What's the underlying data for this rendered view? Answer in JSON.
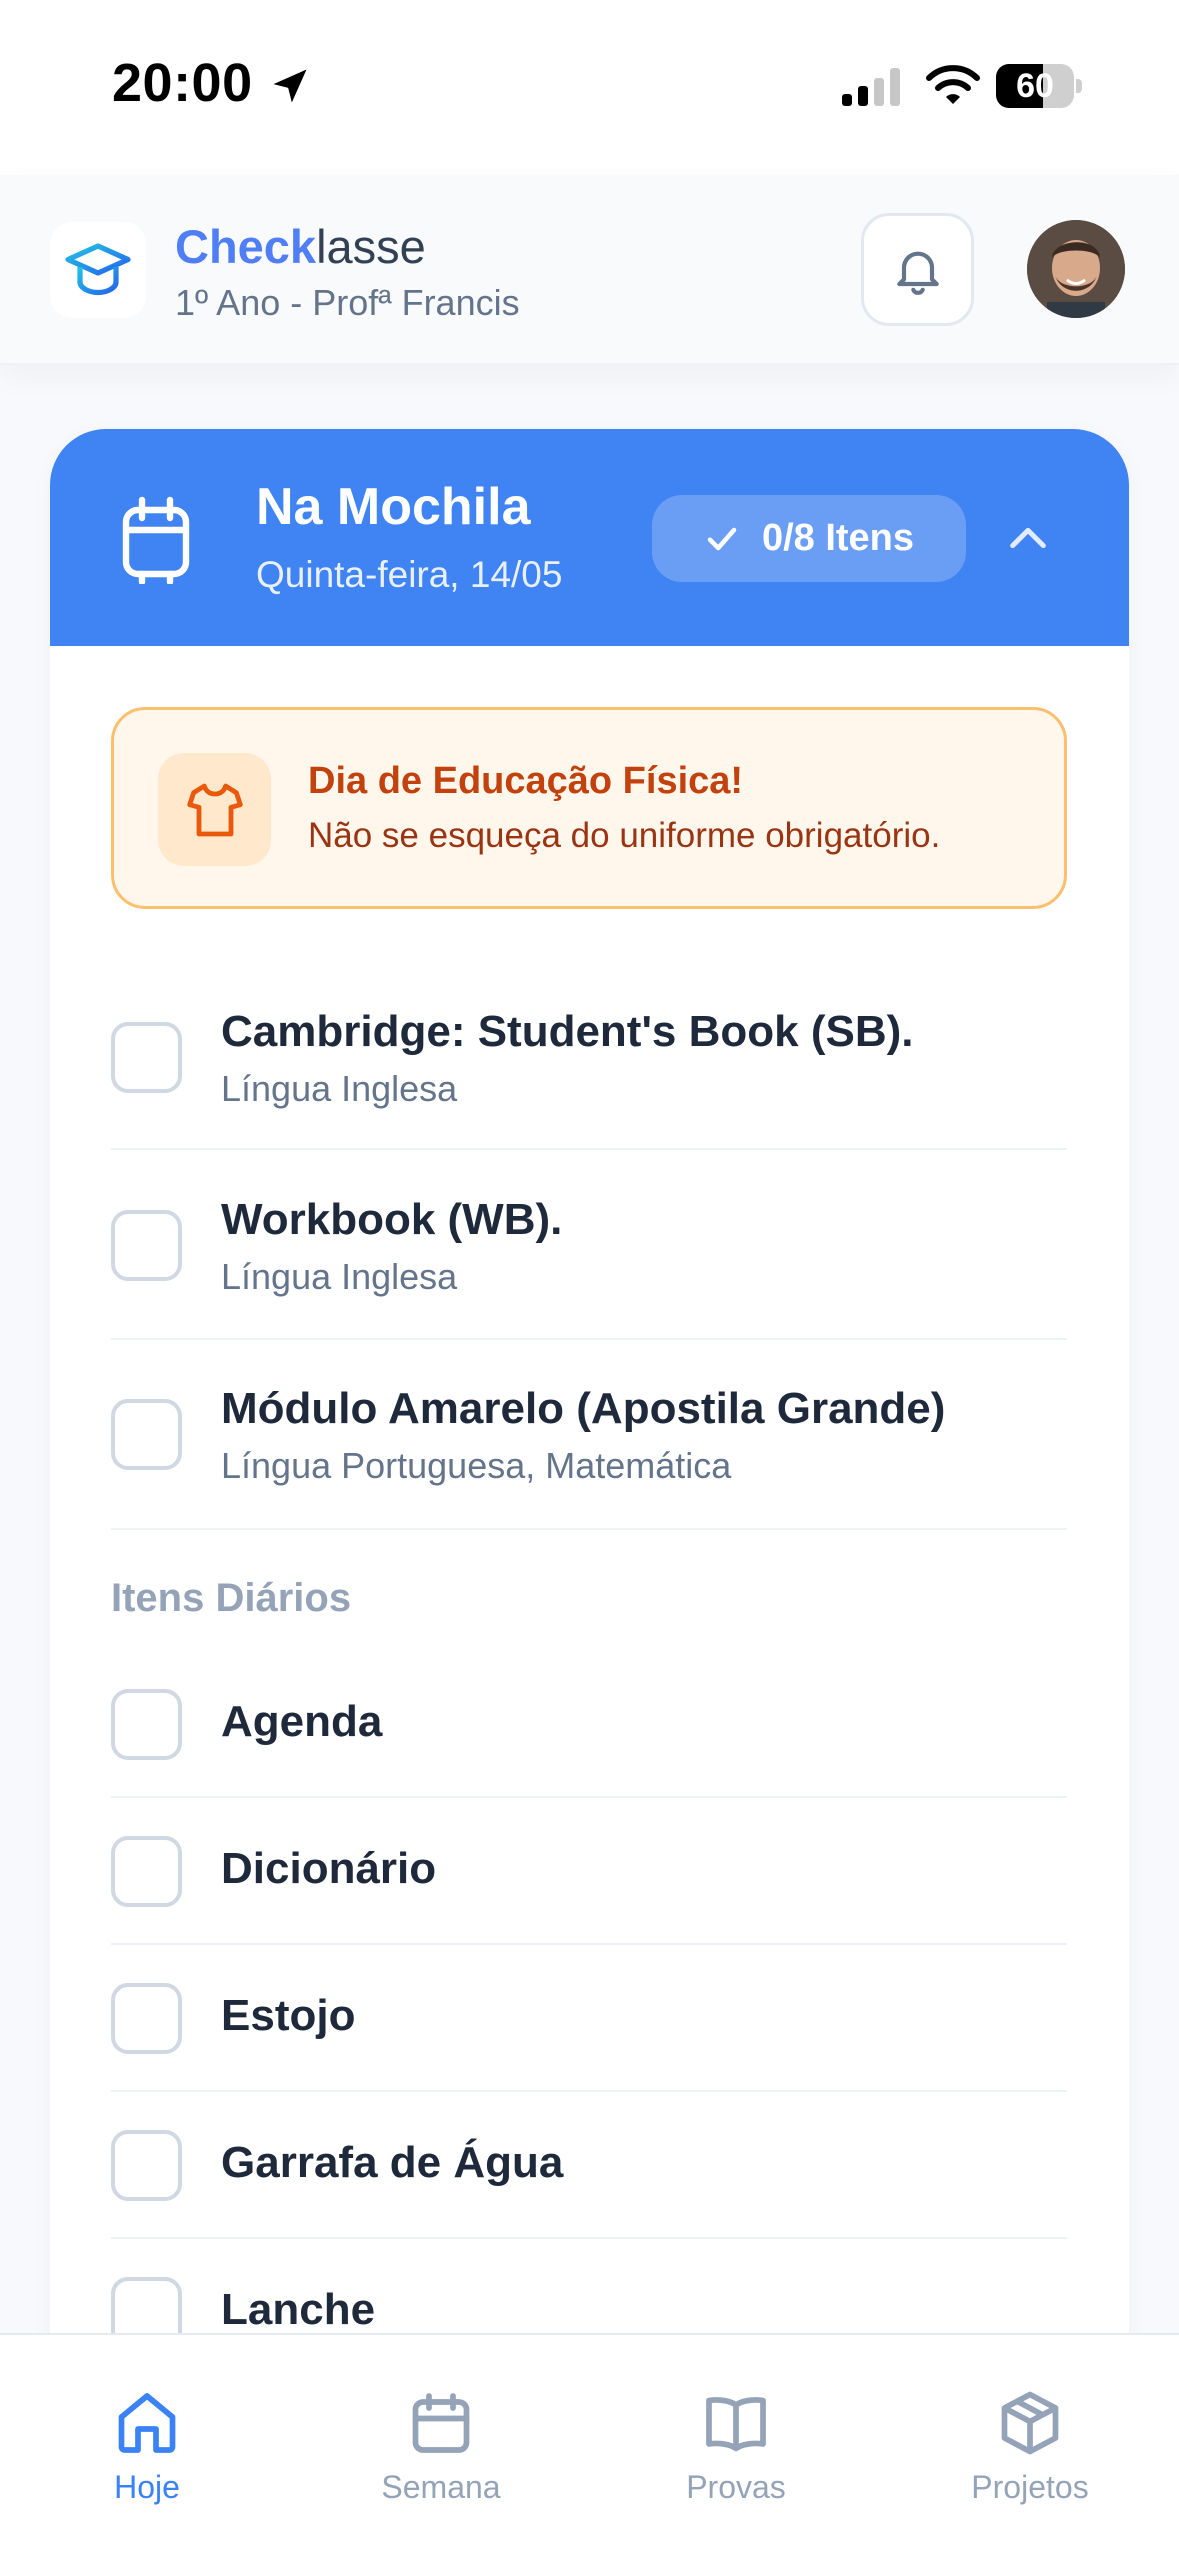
{
  "status_bar": {
    "time": "20:00",
    "battery_level": 60,
    "battery_text": "60"
  },
  "header": {
    "brand_strong": "Check",
    "brand_rest": "lasse",
    "subtitle": "1º Ano - Profª Francis"
  },
  "card": {
    "title": "Na Mochila",
    "date": "Quinta-feira, 14/05",
    "count_label": "0/8 Itens",
    "accent_color": "#4083f3"
  },
  "alert": {
    "title": "Dia de Educação Física!",
    "text": "Não se esqueça do uniforme obrigatório.",
    "icon": "shirt-icon"
  },
  "items": [
    {
      "title": "Cambridge: Student's Book (SB).",
      "subtitle": "Língua Inglesa",
      "checked": false
    },
    {
      "title": "Workbook (WB).",
      "subtitle": "Língua Inglesa",
      "checked": false
    },
    {
      "title": "Módulo Amarelo (Apostila Grande)",
      "subtitle": "Língua Portuguesa, Matemática",
      "checked": false
    }
  ],
  "daily_section_label": "Itens Diários",
  "daily_items": [
    {
      "title": "Agenda",
      "checked": false
    },
    {
      "title": "Dicionário",
      "checked": false
    },
    {
      "title": "Estojo",
      "checked": false
    },
    {
      "title": "Garrafa de Água",
      "checked": false
    },
    {
      "title": "Lanche",
      "checked": false
    }
  ],
  "nav": [
    {
      "label": "Hoje",
      "icon": "home-icon",
      "active": true
    },
    {
      "label": "Semana",
      "icon": "calendar-icon",
      "active": false
    },
    {
      "label": "Provas",
      "icon": "book-icon",
      "active": false
    },
    {
      "label": "Projetos",
      "icon": "box-icon",
      "active": false
    }
  ]
}
